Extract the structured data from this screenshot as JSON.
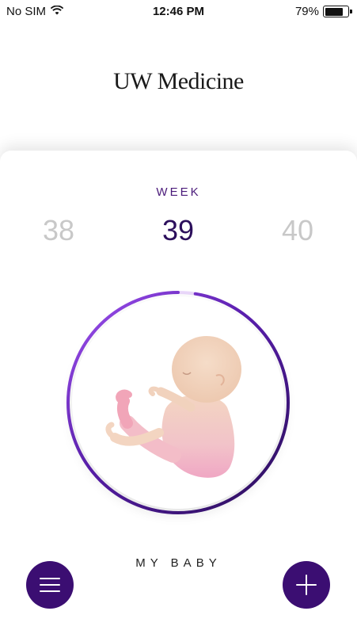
{
  "status_bar": {
    "carrier": "No SIM",
    "time": "12:46 PM",
    "battery_percent_label": "79%",
    "battery_level": 0.79,
    "wifi_icon": "wifi-icon",
    "battery_icon": "battery-icon"
  },
  "header": {
    "logo_text": "UW Medicine"
  },
  "week_selector": {
    "label": "WEEK",
    "previous": "38",
    "current": "39",
    "next": "40"
  },
  "progress_ring": {
    "progress_fraction": 0.975,
    "color_start": "#2c0f5c",
    "color_end": "#a455f5"
  },
  "baby": {
    "label": "MY BABY",
    "illustration_icon": "fetus-illustration"
  },
  "actions": {
    "menu_icon": "hamburger-menu-icon",
    "add_icon": "plus-icon",
    "accent_color": "#3b0e72"
  },
  "colors": {
    "week_current": "#2c0f5c",
    "week_inactive": "#c8c8c8",
    "week_label": "#4a1a7a"
  }
}
